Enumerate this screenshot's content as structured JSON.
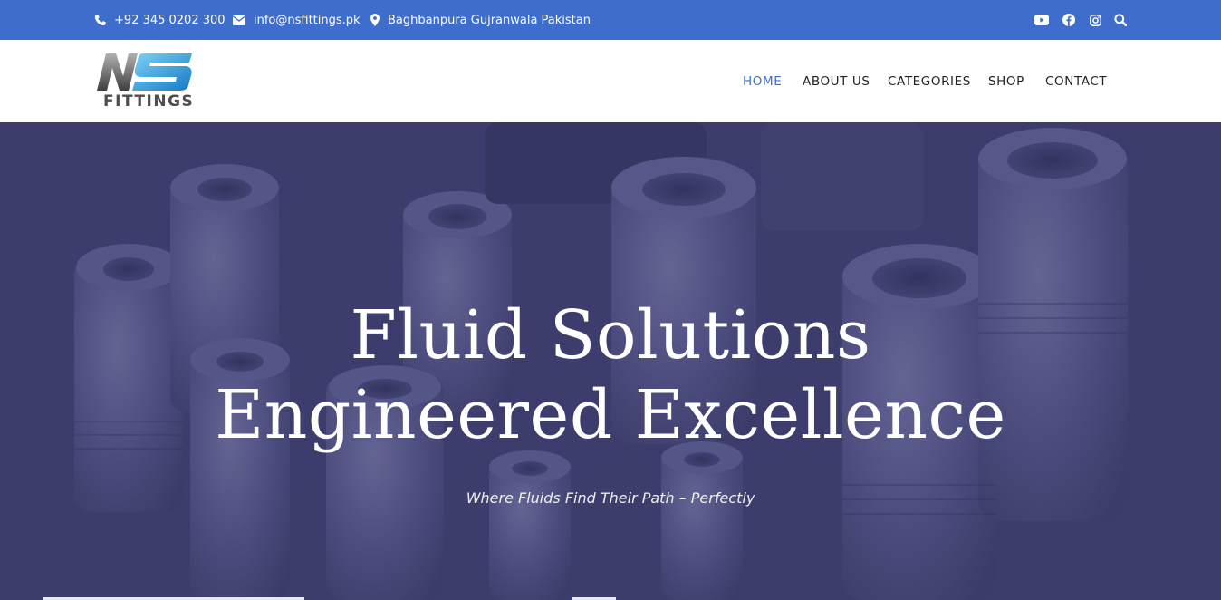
{
  "topbar": {
    "phone": "+92 345 0202 300",
    "email": "info@nsfittings.pk",
    "address": "Baghbanpura Gujranwala Pakistan",
    "icons": [
      "phone-icon",
      "envelope-icon",
      "map-pin-icon",
      "youtube-icon",
      "facebook-icon",
      "instagram-icon",
      "search-icon"
    ],
    "bg_color": "#3f6dcc"
  },
  "header": {
    "logo_letters": "NS",
    "logo_word": "FITTINGS",
    "nav": [
      {
        "label": "HOME",
        "active": true
      },
      {
        "label": "ABOUT US",
        "active": false
      },
      {
        "label": "CATEGORIES",
        "active": false
      },
      {
        "label": "SHOP",
        "active": false
      },
      {
        "label": "CONTACT",
        "active": false
      }
    ],
    "accent_color": "#3f6dcc"
  },
  "hero": {
    "title_line1": "Fluid Solutions",
    "title_line2": "Engineered Excellence",
    "subtitle": "Where Fluids Find Their Path – Perfectly",
    "overlay_color": "#3b3c6b"
  }
}
